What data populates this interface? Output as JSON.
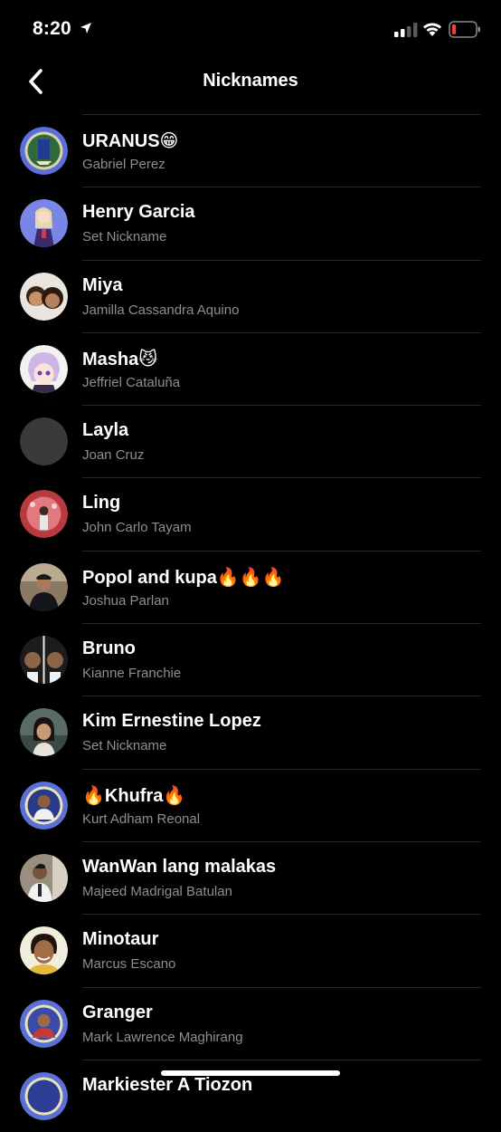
{
  "status_bar": {
    "time": "8:20",
    "battery_color": "#ff3b30"
  },
  "header": {
    "title": "Nicknames",
    "back_icon": "chevron-left-icon"
  },
  "contacts": [
    {
      "nickname": "URANUS😁",
      "name": "Gabriel Perez",
      "avatar": "photo"
    },
    {
      "nickname": "Henry Garcia",
      "name": "Set Nickname",
      "avatar": "photo"
    },
    {
      "nickname": "Miya",
      "name": "Jamilla Cassandra Aquino",
      "avatar": "photo"
    },
    {
      "nickname": "Masha😼",
      "name": "Jeffriel Cataluña",
      "avatar": "photo"
    },
    {
      "nickname": "Layla",
      "name": "Joan Cruz",
      "avatar": "placeholder"
    },
    {
      "nickname": "Ling",
      "name": "John Carlo Tayam",
      "avatar": "photo"
    },
    {
      "nickname": "Popol and kupa🔥🔥🔥",
      "name": "Joshua Parlan",
      "avatar": "photo"
    },
    {
      "nickname": "Bruno",
      "name": "Kianne Franchie",
      "avatar": "photo"
    },
    {
      "nickname": "Kim Ernestine Lopez",
      "name": "Set Nickname",
      "avatar": "photo"
    },
    {
      "nickname": "🔥Khufra🔥",
      "name": "Kurt Adham Reonal",
      "avatar": "photo"
    },
    {
      "nickname": "WanWan lang malakas",
      "name": "Majeed Madrigal Batulan",
      "avatar": "photo"
    },
    {
      "nickname": "Minotaur",
      "name": "Marcus Escano",
      "avatar": "photo"
    },
    {
      "nickname": "Granger",
      "name": "Mark Lawrence Maghirang",
      "avatar": "photo"
    },
    {
      "nickname": "Markiester A Tiozon",
      "name": "",
      "avatar": "photo"
    }
  ]
}
